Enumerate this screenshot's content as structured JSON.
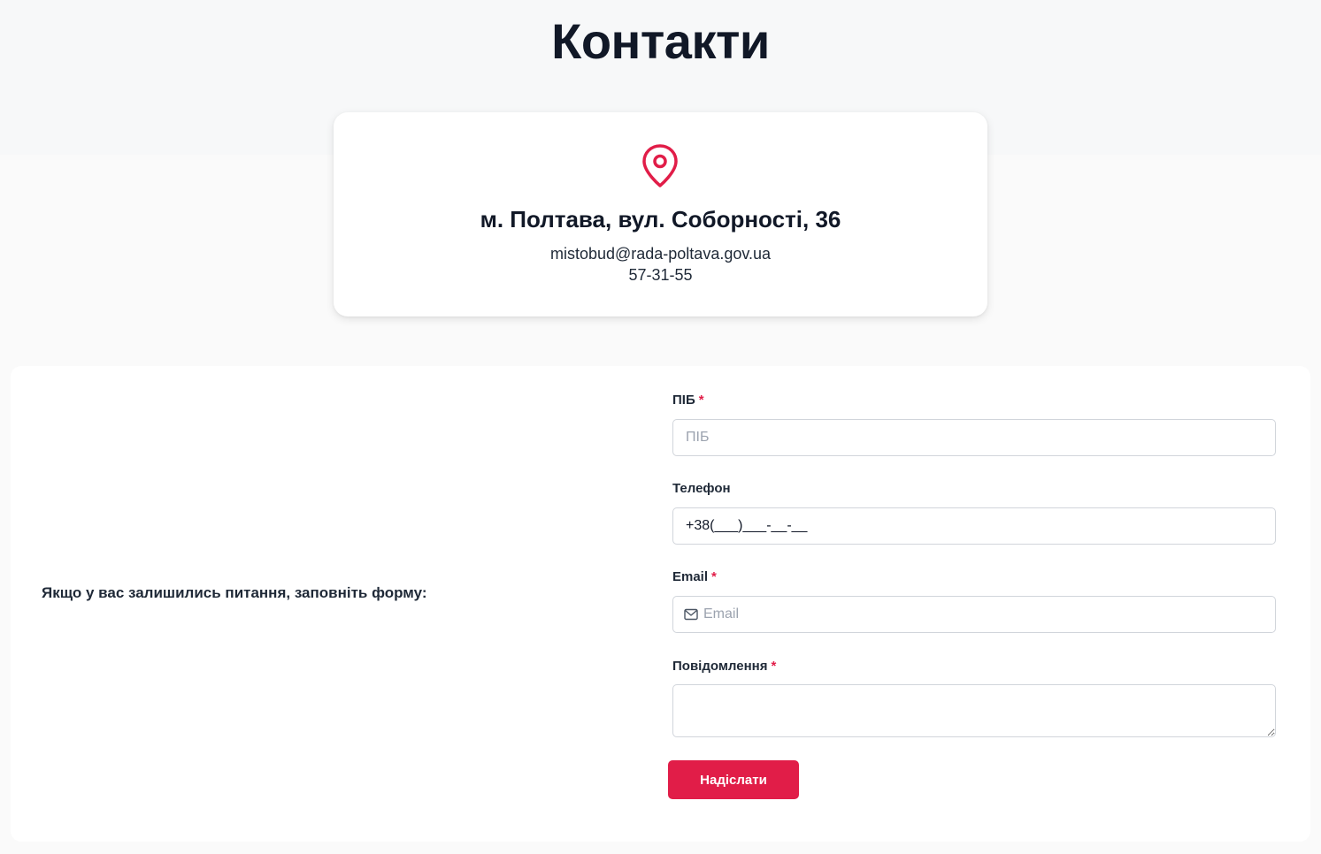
{
  "page": {
    "title": "Контакти"
  },
  "contact": {
    "address": "м. Полтава, вул. Соборності, 36",
    "email": "mistobud@rada-poltava.gov.ua",
    "phone": "57-31-55",
    "icon": "map-pin-icon"
  },
  "form": {
    "intro": "Якщо у вас залишились питання, заповніть форму:",
    "fields": {
      "name": {
        "label": "ПІБ",
        "placeholder": "ПІБ",
        "required": "*"
      },
      "phone": {
        "label": "Телефон",
        "value": "+38(___)___-__-__"
      },
      "email": {
        "label": "Email",
        "placeholder": "Email",
        "required": "*",
        "icon": "mail-icon"
      },
      "message": {
        "label": "Повідомлення",
        "required": "*"
      }
    },
    "submit_label": "Надіслати"
  },
  "colors": {
    "accent": "#e11d48",
    "text_dark": "#111827",
    "border": "#d1d5db"
  }
}
